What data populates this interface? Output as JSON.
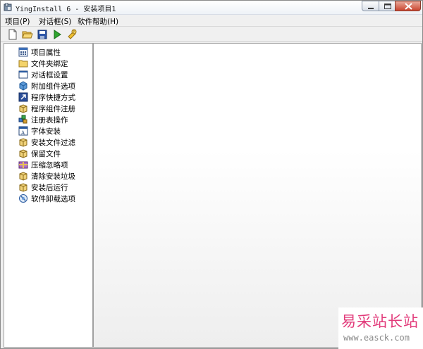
{
  "window": {
    "title": "YingInstall 6 - 安装项目1"
  },
  "menubar": {
    "items": [
      {
        "label": "项目(P)"
      },
      {
        "label": "对话框(S)"
      },
      {
        "label": "软件帮助(H)"
      }
    ]
  },
  "toolbar": {
    "buttons": [
      {
        "icon": "new-file-icon"
      },
      {
        "icon": "open-folder-icon"
      },
      {
        "icon": "save-icon"
      },
      {
        "icon": "run-icon"
      },
      {
        "icon": "help-icon"
      }
    ]
  },
  "tree": {
    "items": [
      {
        "label": "项目属性",
        "icon": "properties-icon"
      },
      {
        "label": "文件夹绑定",
        "icon": "folder-icon"
      },
      {
        "label": "对话框设置",
        "icon": "dialog-icon"
      },
      {
        "label": "附加组件选项",
        "icon": "component-icon"
      },
      {
        "label": "程序快捷方式",
        "icon": "shortcut-icon"
      },
      {
        "label": "程序组件注册",
        "icon": "register-icon"
      },
      {
        "label": "注册表操作",
        "icon": "registry-icon"
      },
      {
        "label": "字体安装",
        "icon": "font-icon"
      },
      {
        "label": "安装文件过滤",
        "icon": "filter-icon"
      },
      {
        "label": "保留文件",
        "icon": "keep-file-icon"
      },
      {
        "label": "压缩忽略项",
        "icon": "compress-icon"
      },
      {
        "label": "清除安装垃圾",
        "icon": "clean-icon"
      },
      {
        "label": "安装后运行",
        "icon": "post-run-icon"
      },
      {
        "label": "软件卸载选项",
        "icon": "uninstall-icon"
      }
    ]
  },
  "watermark": {
    "title": "易采站长站",
    "url": "www.easck.com"
  }
}
